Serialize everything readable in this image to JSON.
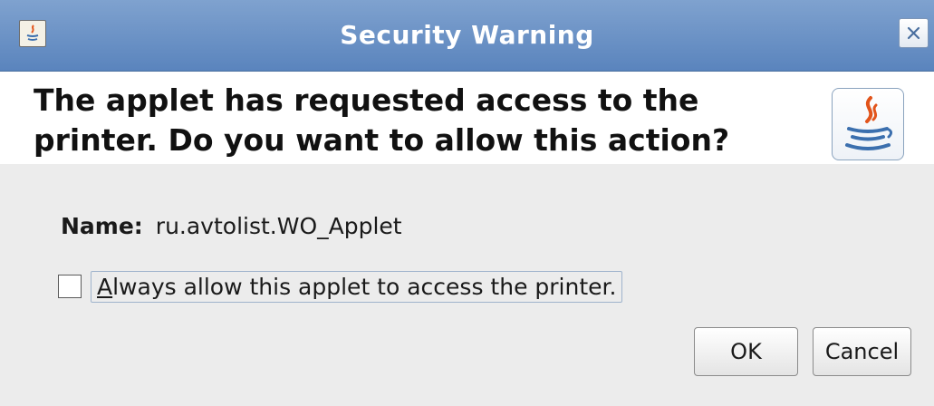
{
  "window": {
    "title": "Security Warning",
    "app_icon": "java-applet-icon",
    "close_icon": "close-icon"
  },
  "header": {
    "message": "The applet has requested access to the printer.  Do you want to allow this action?",
    "logo_icon": "java-logo-icon"
  },
  "details": {
    "name_label": "Name:",
    "name_value": "ru.avtolist.WO_Applet"
  },
  "checkbox": {
    "label": "Always allow this applet to access the printer.",
    "mnemonic": "A",
    "checked": false
  },
  "buttons": {
    "ok_label": "OK",
    "cancel_label": "Cancel"
  },
  "colors": {
    "titlebar": "#6b90c6",
    "header_bg": "#ffffff",
    "dialog_bg": "#ececec",
    "java_red": "#e2541b",
    "java_blue": "#3b6fae"
  }
}
